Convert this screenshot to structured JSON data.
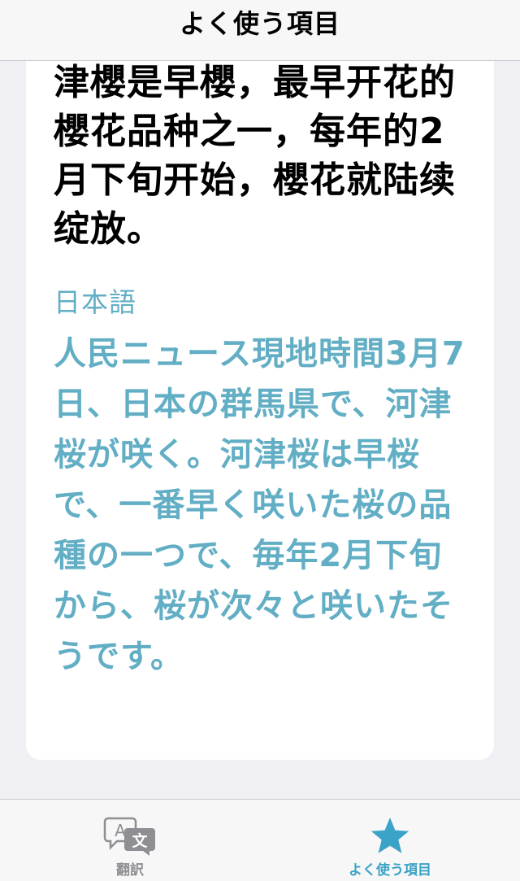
{
  "nav": {
    "title": "よく使う項目"
  },
  "card": {
    "source_text": "津櫻是早櫻，最早开花的櫻花品种之一，每年的2月下旬开始，櫻花就陆续绽放。",
    "target_language": "日本語",
    "target_text": "人民ニュース現地時間3月7日、日本の群馬県で、河津桜が咲く。河津桜は早桜で、一番早く咲いた桜の品種の一つで、毎年2月下旬から、桜が次々と咲いたそうです。"
  },
  "tab_bar": {
    "tabs": [
      {
        "label": "翻訳",
        "icon": "translate-icon",
        "selected": false
      },
      {
        "label": "よく使う項目",
        "icon": "star-icon",
        "selected": true
      }
    ]
  },
  "colors": {
    "accent": "#3aa3c7",
    "translation_text": "#62aec4",
    "background": "#efeff4",
    "card": "#ffffff",
    "inactive_tab": "#8e8e93"
  }
}
